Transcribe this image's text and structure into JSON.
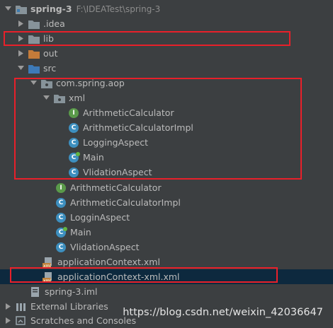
{
  "project": {
    "name": "spring-3",
    "path": "F:\\IDEATest\\spring-3"
  },
  "tree": {
    "idea": ".idea",
    "lib": "lib",
    "out": "out",
    "src": "src",
    "package": "com.spring.aop",
    "xml_folder": "xml",
    "xml_items": [
      {
        "label": "ArithmeticCalculator",
        "kind": "I"
      },
      {
        "label": "ArithmeticCalculatorImpl",
        "kind": "C"
      },
      {
        "label": "LoggingAspect",
        "kind": "C"
      },
      {
        "label": "Main",
        "kind": "C"
      },
      {
        "label": "VlidationAspect",
        "kind": "C"
      }
    ],
    "pkg_items": [
      {
        "label": "ArithmeticCalculator",
        "kind": "I"
      },
      {
        "label": "ArithmeticCalculatorImpl",
        "kind": "C"
      },
      {
        "label": "LogginAspect",
        "kind": "C"
      },
      {
        "label": "Main",
        "kind": "C"
      },
      {
        "label": "VlidationAspect",
        "kind": "C"
      }
    ],
    "app_context": "applicationContext.xml",
    "app_context_xml": "applicationContext-xml.xml",
    "iml": "spring-3.iml",
    "external_libraries": "External Libraries",
    "scratches": "Scratches and Consoles"
  },
  "watermark": "https://blog.csdn.net/weixin_42036647",
  "colors": {
    "background": "#3c3f41",
    "highlight_box": "#e8202a",
    "selected_row": "#0d293e",
    "folder": "#87939a",
    "class_badge": "#3d8fbf",
    "interface_badge": "#5a9a4a"
  }
}
